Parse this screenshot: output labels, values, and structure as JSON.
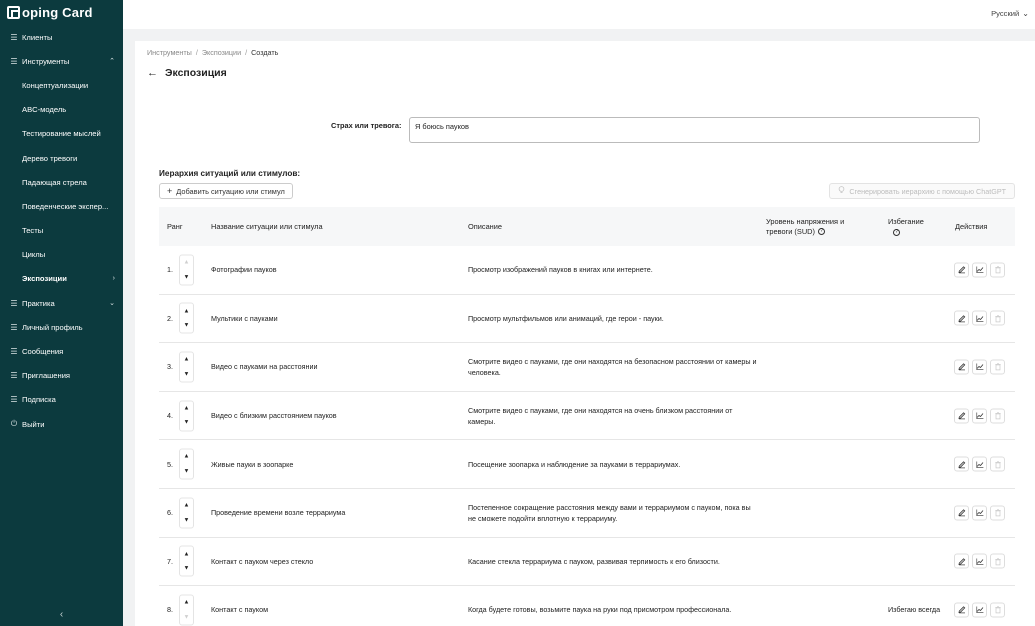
{
  "app": {
    "logo_text": "oping Card",
    "logo_letter": "C"
  },
  "sidebar": {
    "items": [
      {
        "label": "Клиенты",
        "icon": "list-icon",
        "chevron": ""
      },
      {
        "label": "Инструменты",
        "icon": "list-icon",
        "chevron": "⌃"
      },
      {
        "label": "Концептуализации",
        "sub": true
      },
      {
        "label": "ABC-модель",
        "sub": true
      },
      {
        "label": "Тестирование мыслей",
        "sub": true
      },
      {
        "label": "Дерево тревоги",
        "sub": true
      },
      {
        "label": "Падающая стрела",
        "sub": true
      },
      {
        "label": "Поведенческие экспер...",
        "sub": true
      },
      {
        "label": "Тесты",
        "sub": true
      },
      {
        "label": "Циклы",
        "sub": true
      },
      {
        "label": "Экспозиции",
        "sub": true,
        "active": true,
        "chevron": "›"
      },
      {
        "label": "Практика",
        "icon": "list-icon",
        "chevron": "⌄"
      },
      {
        "label": "Личный профиль",
        "icon": "list-icon"
      },
      {
        "label": "Сообщения",
        "icon": "list-icon"
      },
      {
        "label": "Приглашения",
        "icon": "list-icon"
      },
      {
        "label": "Подписка",
        "icon": "list-icon"
      },
      {
        "label": "Выйти",
        "icon": "logout-icon"
      }
    ],
    "collapse": "‹"
  },
  "topbar": {
    "language": "Русский"
  },
  "breadcrumb": {
    "items": [
      "Инструменты",
      "Экспозиции"
    ],
    "current": "Создать"
  },
  "page": {
    "title": "Экспозиция"
  },
  "form": {
    "fear_label": "Страх или тревога:",
    "fear_value": "Я боюсь пауков"
  },
  "hierarchy": {
    "title": "Иерархия ситуаций или стимулов:",
    "add_button": "Добавить ситуацию или стимул",
    "generate_button": "Сгенерировать иерархию с помощью ChatGPT"
  },
  "table": {
    "headers": {
      "rank": "Ранг",
      "name": "Название ситуации или стимула",
      "description": "Описание",
      "sud": "Уровень напряжения и тревоги (SUD)",
      "avoidance": "Избегание",
      "actions": "Действия"
    },
    "rows": [
      {
        "rank": "1.",
        "name": "Фотографии пауков",
        "description": "Просмотр изображений пауков в книгах или интернете.",
        "avoidance": ""
      },
      {
        "rank": "2.",
        "name": "Мультики с пауками",
        "description": "Просмотр мультфильмов или анимаций, где герои - пауки.",
        "avoidance": ""
      },
      {
        "rank": "3.",
        "name": "Видео с пауками на расстоянии",
        "description": "Смотрите видео с пауками, где они находятся на безопасном расстоянии от камеры и человека.",
        "avoidance": ""
      },
      {
        "rank": "4.",
        "name": "Видео с близким расстоянием пауков",
        "description": "Смотрите видео с пауками, где они находятся на очень близком расстоянии от камеры.",
        "avoidance": ""
      },
      {
        "rank": "5.",
        "name": "Живые пауки в зоопарке",
        "description": "Посещение зоопарка и наблюдение за пауками в террариумах.",
        "avoidance": ""
      },
      {
        "rank": "6.",
        "name": "Проведение времени возле террариума",
        "description": "Постепенное сокращение расстояния между вами и террариумом с пауком, пока вы не сможете подойти вплотную к террариуму.",
        "avoidance": ""
      },
      {
        "rank": "7.",
        "name": "Контакт с пауком через стекло",
        "description": "Касание стекла террариума с пауком, развивая терпимость к его близости.",
        "avoidance": ""
      },
      {
        "rank": "8.",
        "name": "Контакт с пауком",
        "description": "Когда будете готовы, возьмите паука на руки под присмотром профессионала.",
        "avoidance": "Избегаю всегда"
      }
    ]
  }
}
